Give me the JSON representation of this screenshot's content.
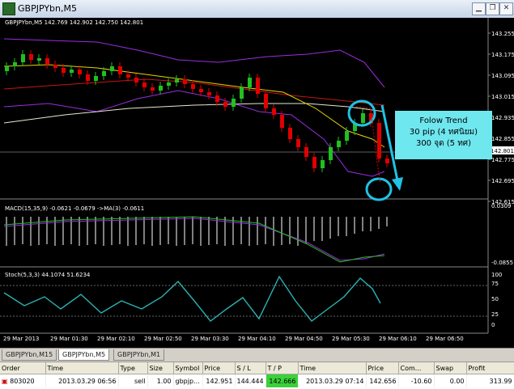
{
  "window": {
    "title": "GBPJPYbn,M5"
  },
  "chart": {
    "header": "GBPJPYbn,M5  142.769 142.902 142.750 142.801",
    "price_ticks": [
      "143.255",
      "143.175",
      "143.095",
      "143.015",
      "142.935",
      "142.855",
      "142.775",
      "142.695",
      "142.615"
    ],
    "current_price": "142.801",
    "macd_label": "MACD(15,35,9) -0.0621 -0.0679 ->MA(3) -0.0611",
    "macd_ticks": [
      "0.0309",
      "-0.0855"
    ],
    "stoch_label": "Stoch(5,3,3) 44.1074 51.6234",
    "stoch_ticks": [
      "100",
      "75",
      "50",
      "25",
      "0"
    ],
    "time_ticks": [
      "29 Mar 2013",
      "29 Mar 01:30",
      "29 Mar 02:10",
      "29 Mar 02:50",
      "29 Mar 03:30",
      "29 Mar 04:10",
      "29 Mar 04:50",
      "29 Mar 05:30",
      "29 Mar 06:10",
      "29 Mar 06:50"
    ],
    "annotation": {
      "line1": "Folow Trend",
      "line2": "30 pip (4 ทศนิยม)",
      "line3": "300 จุด (5 ทศ)"
    },
    "colors": {
      "bull": "#21c021",
      "bear": "#e00000",
      "bands": "#9a2de0",
      "ma_fast": "#e6d400",
      "ma_slow": "#c81414",
      "ma_long": "#e8e8d0",
      "stoch": "#2ab3b3",
      "annotation": "#1ec3e5"
    }
  },
  "tabs": [
    {
      "label": "GBPJPYbn,M15",
      "active": false
    },
    {
      "label": "GBPJPYbn,M5",
      "active": true
    },
    {
      "label": "GBPJPYbn,M1",
      "active": false
    }
  ],
  "orders": {
    "columns": [
      "Order",
      "Time",
      "Type",
      "Size",
      "Symbol",
      "Price",
      "S / L",
      "T / P",
      "Time",
      "Price",
      "Com...",
      "Swap",
      "Profit"
    ],
    "rows": [
      {
        "order": "803020",
        "time": "2013.03.29 06:56",
        "type": "sell",
        "size": "1.00",
        "symbol": "gbpjp...",
        "price": "142.951",
        "sl": "144.444",
        "tp": "142.666",
        "time2": "2013.03.29 07:14",
        "price2": "142.656",
        "commission": "-10.60",
        "swap": "0.00",
        "profit": "313.99"
      }
    ]
  }
}
